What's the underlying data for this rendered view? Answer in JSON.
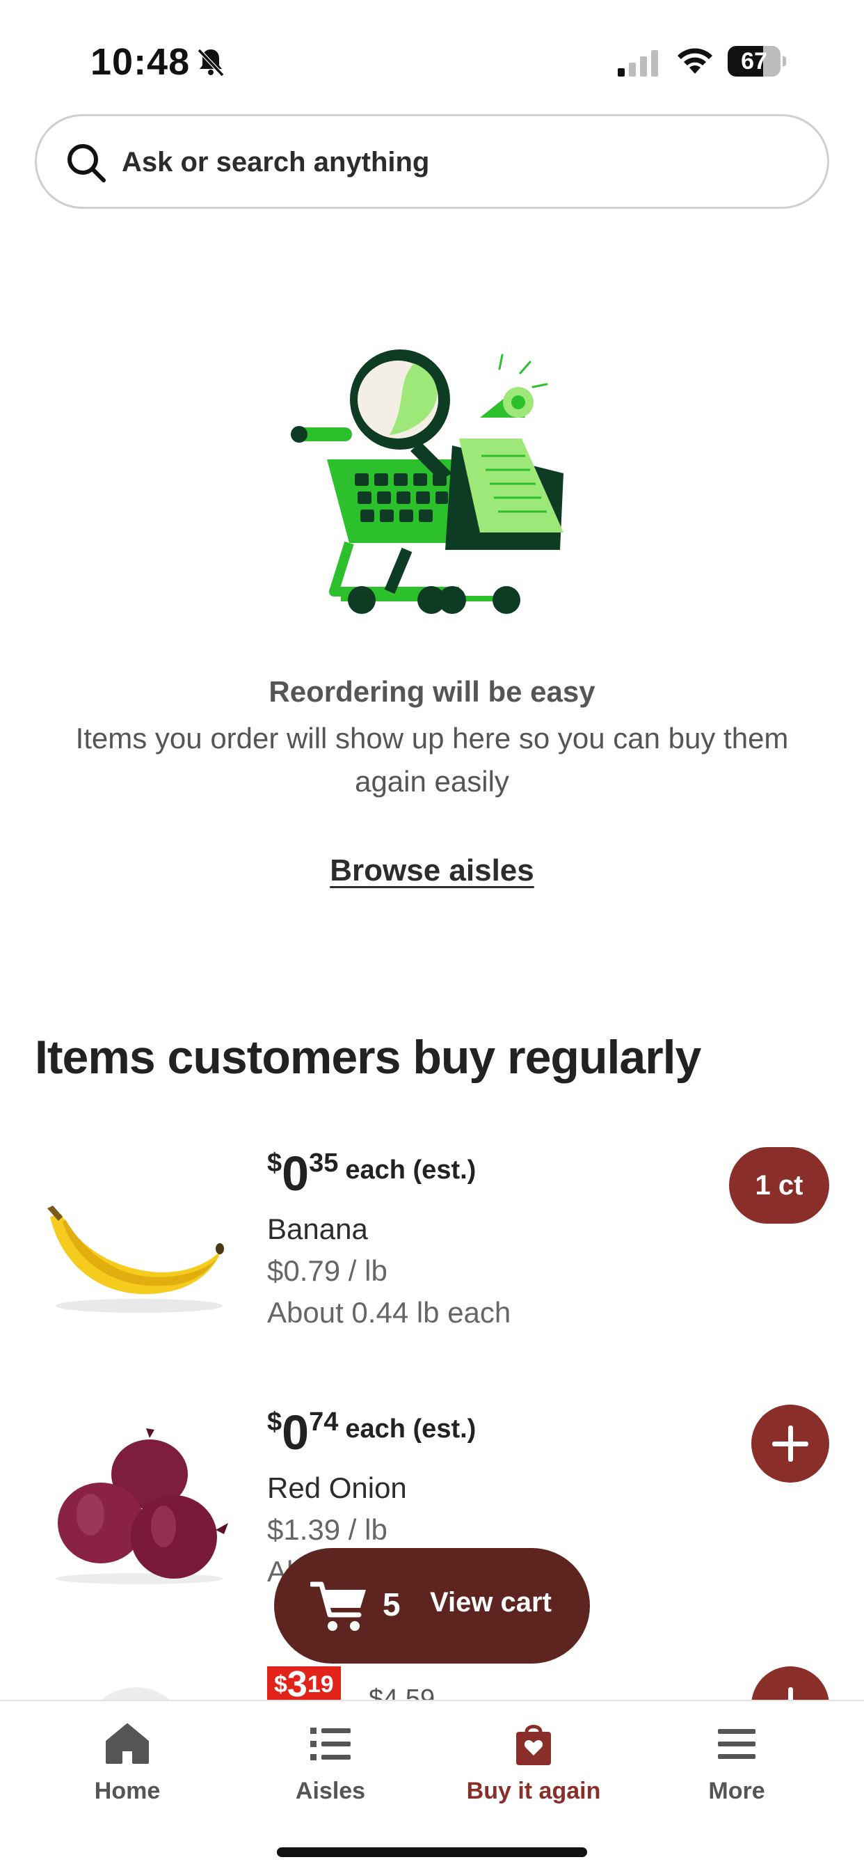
{
  "status_bar": {
    "time": "10:48",
    "battery": "67"
  },
  "search": {
    "placeholder": "Ask or search anything"
  },
  "empty_state": {
    "title": "Reordering will be easy",
    "description": "Items you order will show up here so you can buy them again easily",
    "link": "Browse aisles"
  },
  "section": {
    "title": "Items customers buy regularly"
  },
  "products": [
    {
      "dollar": "$",
      "main": "0",
      "cents": "35",
      "each": "each (est.)",
      "name": "Banana",
      "unit_price": "$0.79 / lb",
      "size": "About 0.44 lb each",
      "quantity": "1 ct"
    },
    {
      "dollar": "$",
      "main": "0",
      "cents": "74",
      "each": "each (est.)",
      "name": "Red Onion",
      "unit_price": "$1.39 / lb",
      "size": "Al"
    },
    {
      "sale_dollar": "$",
      "sale_main": "3",
      "sale_cents": "19",
      "old_price": "$4.59"
    }
  ],
  "cart": {
    "count": "5",
    "label": "View cart"
  },
  "nav": {
    "items": [
      {
        "label": "Home"
      },
      {
        "label": "Aisles"
      },
      {
        "label": "Buy it again"
      },
      {
        "label": "More"
      }
    ],
    "active": "Buy it again"
  },
  "colors": {
    "accent": "#8a2e2a",
    "cart_button": "#5e2420",
    "sale_red": "#e2231a",
    "illustration_green": "#2cc02c"
  }
}
